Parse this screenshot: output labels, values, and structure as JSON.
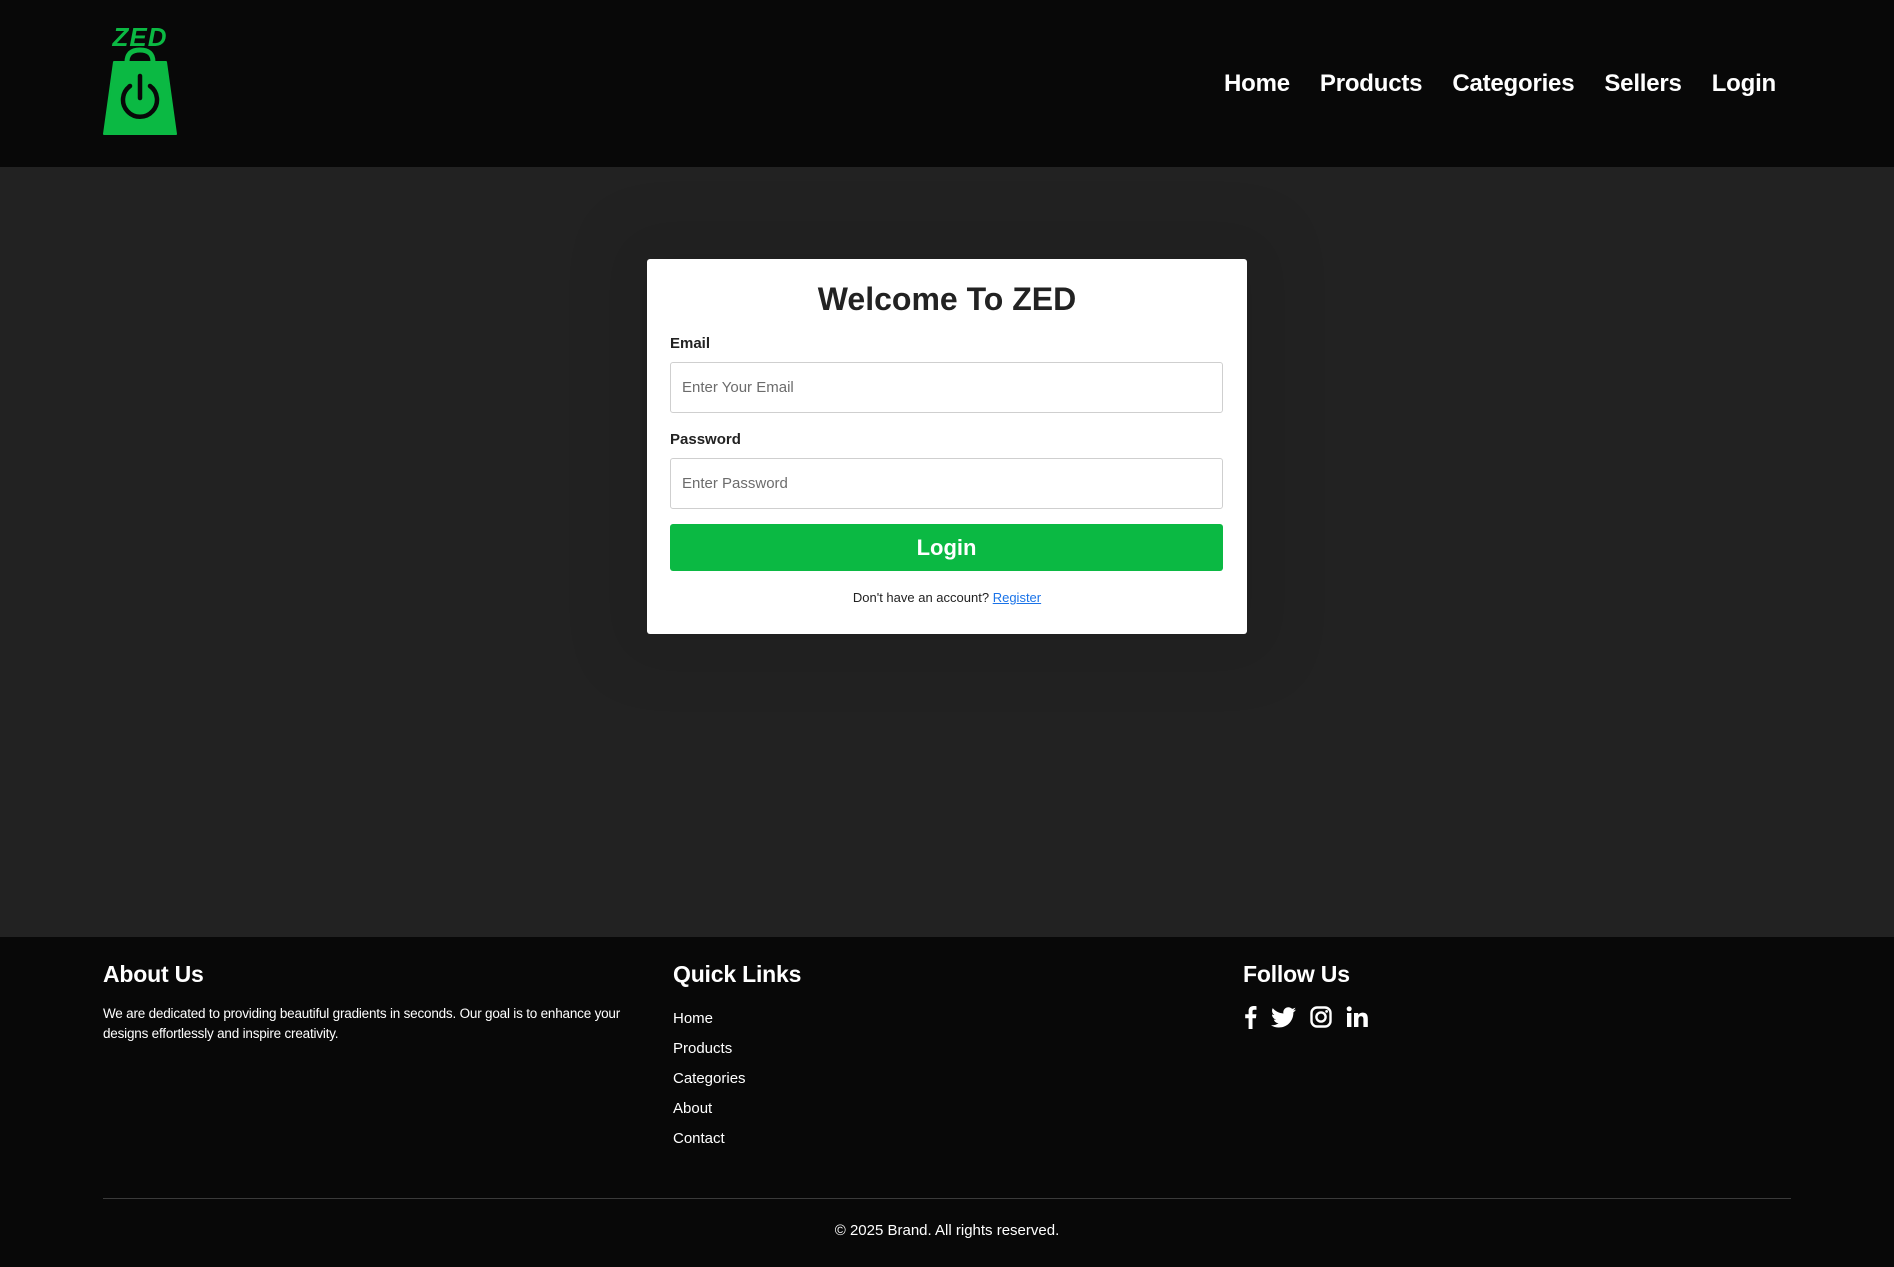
{
  "brand": {
    "logo_text": "ZED",
    "logo_color": "#0bb943"
  },
  "nav": {
    "items": [
      {
        "label": "Home"
      },
      {
        "label": "Products"
      },
      {
        "label": "Categories"
      },
      {
        "label": "Sellers"
      },
      {
        "label": "Login"
      }
    ]
  },
  "login_card": {
    "title": "Welcome To ZED",
    "email": {
      "label": "Email",
      "placeholder": "Enter Your Email",
      "value": ""
    },
    "password": {
      "label": "Password",
      "placeholder": "Enter Password",
      "value": ""
    },
    "submit_label": "Login",
    "submit_color": "#0bb943",
    "register_prompt": "Don't have an account?",
    "register_link": "Register"
  },
  "footer": {
    "about": {
      "heading": "About Us",
      "text": "We are dedicated to providing beautiful gradients in seconds. Our goal is to enhance your designs effortlessly and inspire creativity."
    },
    "quick_links": {
      "heading": "Quick Links",
      "items": [
        {
          "label": "Home"
        },
        {
          "label": "Products"
        },
        {
          "label": "Categories"
        },
        {
          "label": "About"
        },
        {
          "label": "Contact"
        }
      ]
    },
    "follow": {
      "heading": "Follow Us",
      "icons": [
        "facebook-icon",
        "twitter-icon",
        "instagram-icon",
        "linkedin-icon"
      ]
    },
    "copyright": "© 2025 Brand. All rights reserved."
  }
}
